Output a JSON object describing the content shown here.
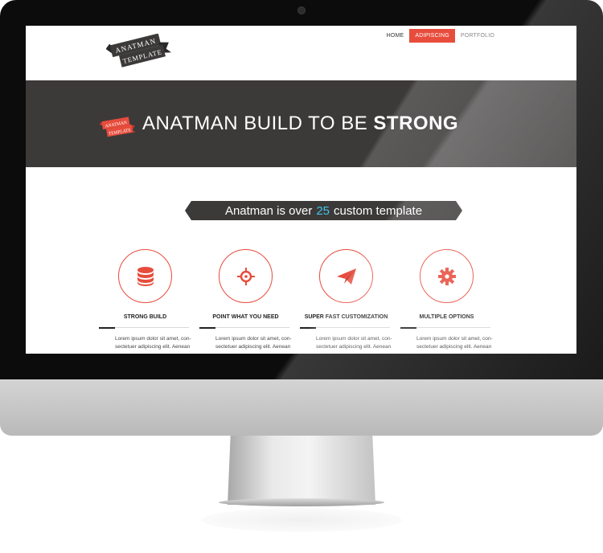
{
  "colors": {
    "accent": "#e74c3c",
    "dark_band": "#3c3939",
    "number_highlight": "#3ec6e8"
  },
  "logo": {
    "line1": "ANATMAN",
    "line2": "TEMPLATE"
  },
  "nav": {
    "items": [
      {
        "label": "HOME",
        "state": "default"
      },
      {
        "label": "ADIPISCING",
        "state": "active"
      },
      {
        "label": "PORTFOLIO",
        "state": "muted"
      }
    ]
  },
  "hero": {
    "badge_line1": "ANATMAN",
    "badge_line2": "TEMPLATE",
    "title_regular": "ANATMAN BUILD TO BE ",
    "title_bold": "STRONG"
  },
  "ribbon": {
    "prefix": "Anatman is over",
    "number": "25",
    "suffix": "custom template"
  },
  "features": [
    {
      "icon": "database-icon",
      "title": "STRONG BUILD",
      "text_line1": "Lorem ipsum dolor sit amet, con-",
      "text_line2": "sectetuer adipiscing elit. Aenean"
    },
    {
      "icon": "crosshair-icon",
      "title": "POINT WHAT YOU NEED",
      "text_line1": "Lorem ipsum dolor sit amet, con-",
      "text_line2": "sectetuer adipiscing elit. Aenean"
    },
    {
      "icon": "paper-plane-icon",
      "title": "SUPER FAST CUSTOMIZATION",
      "text_line1": "Lorem ipsum dolor sit amet, con-",
      "text_line2": "sectetuer adipiscing elit. Aenean"
    },
    {
      "icon": "gear-icon",
      "title": "MULTIPLE OPTIONS",
      "text_line1": "Lorem ipsum dolor sit amet, con-",
      "text_line2": "sectetuer adipiscing elit. Aenean"
    }
  ]
}
